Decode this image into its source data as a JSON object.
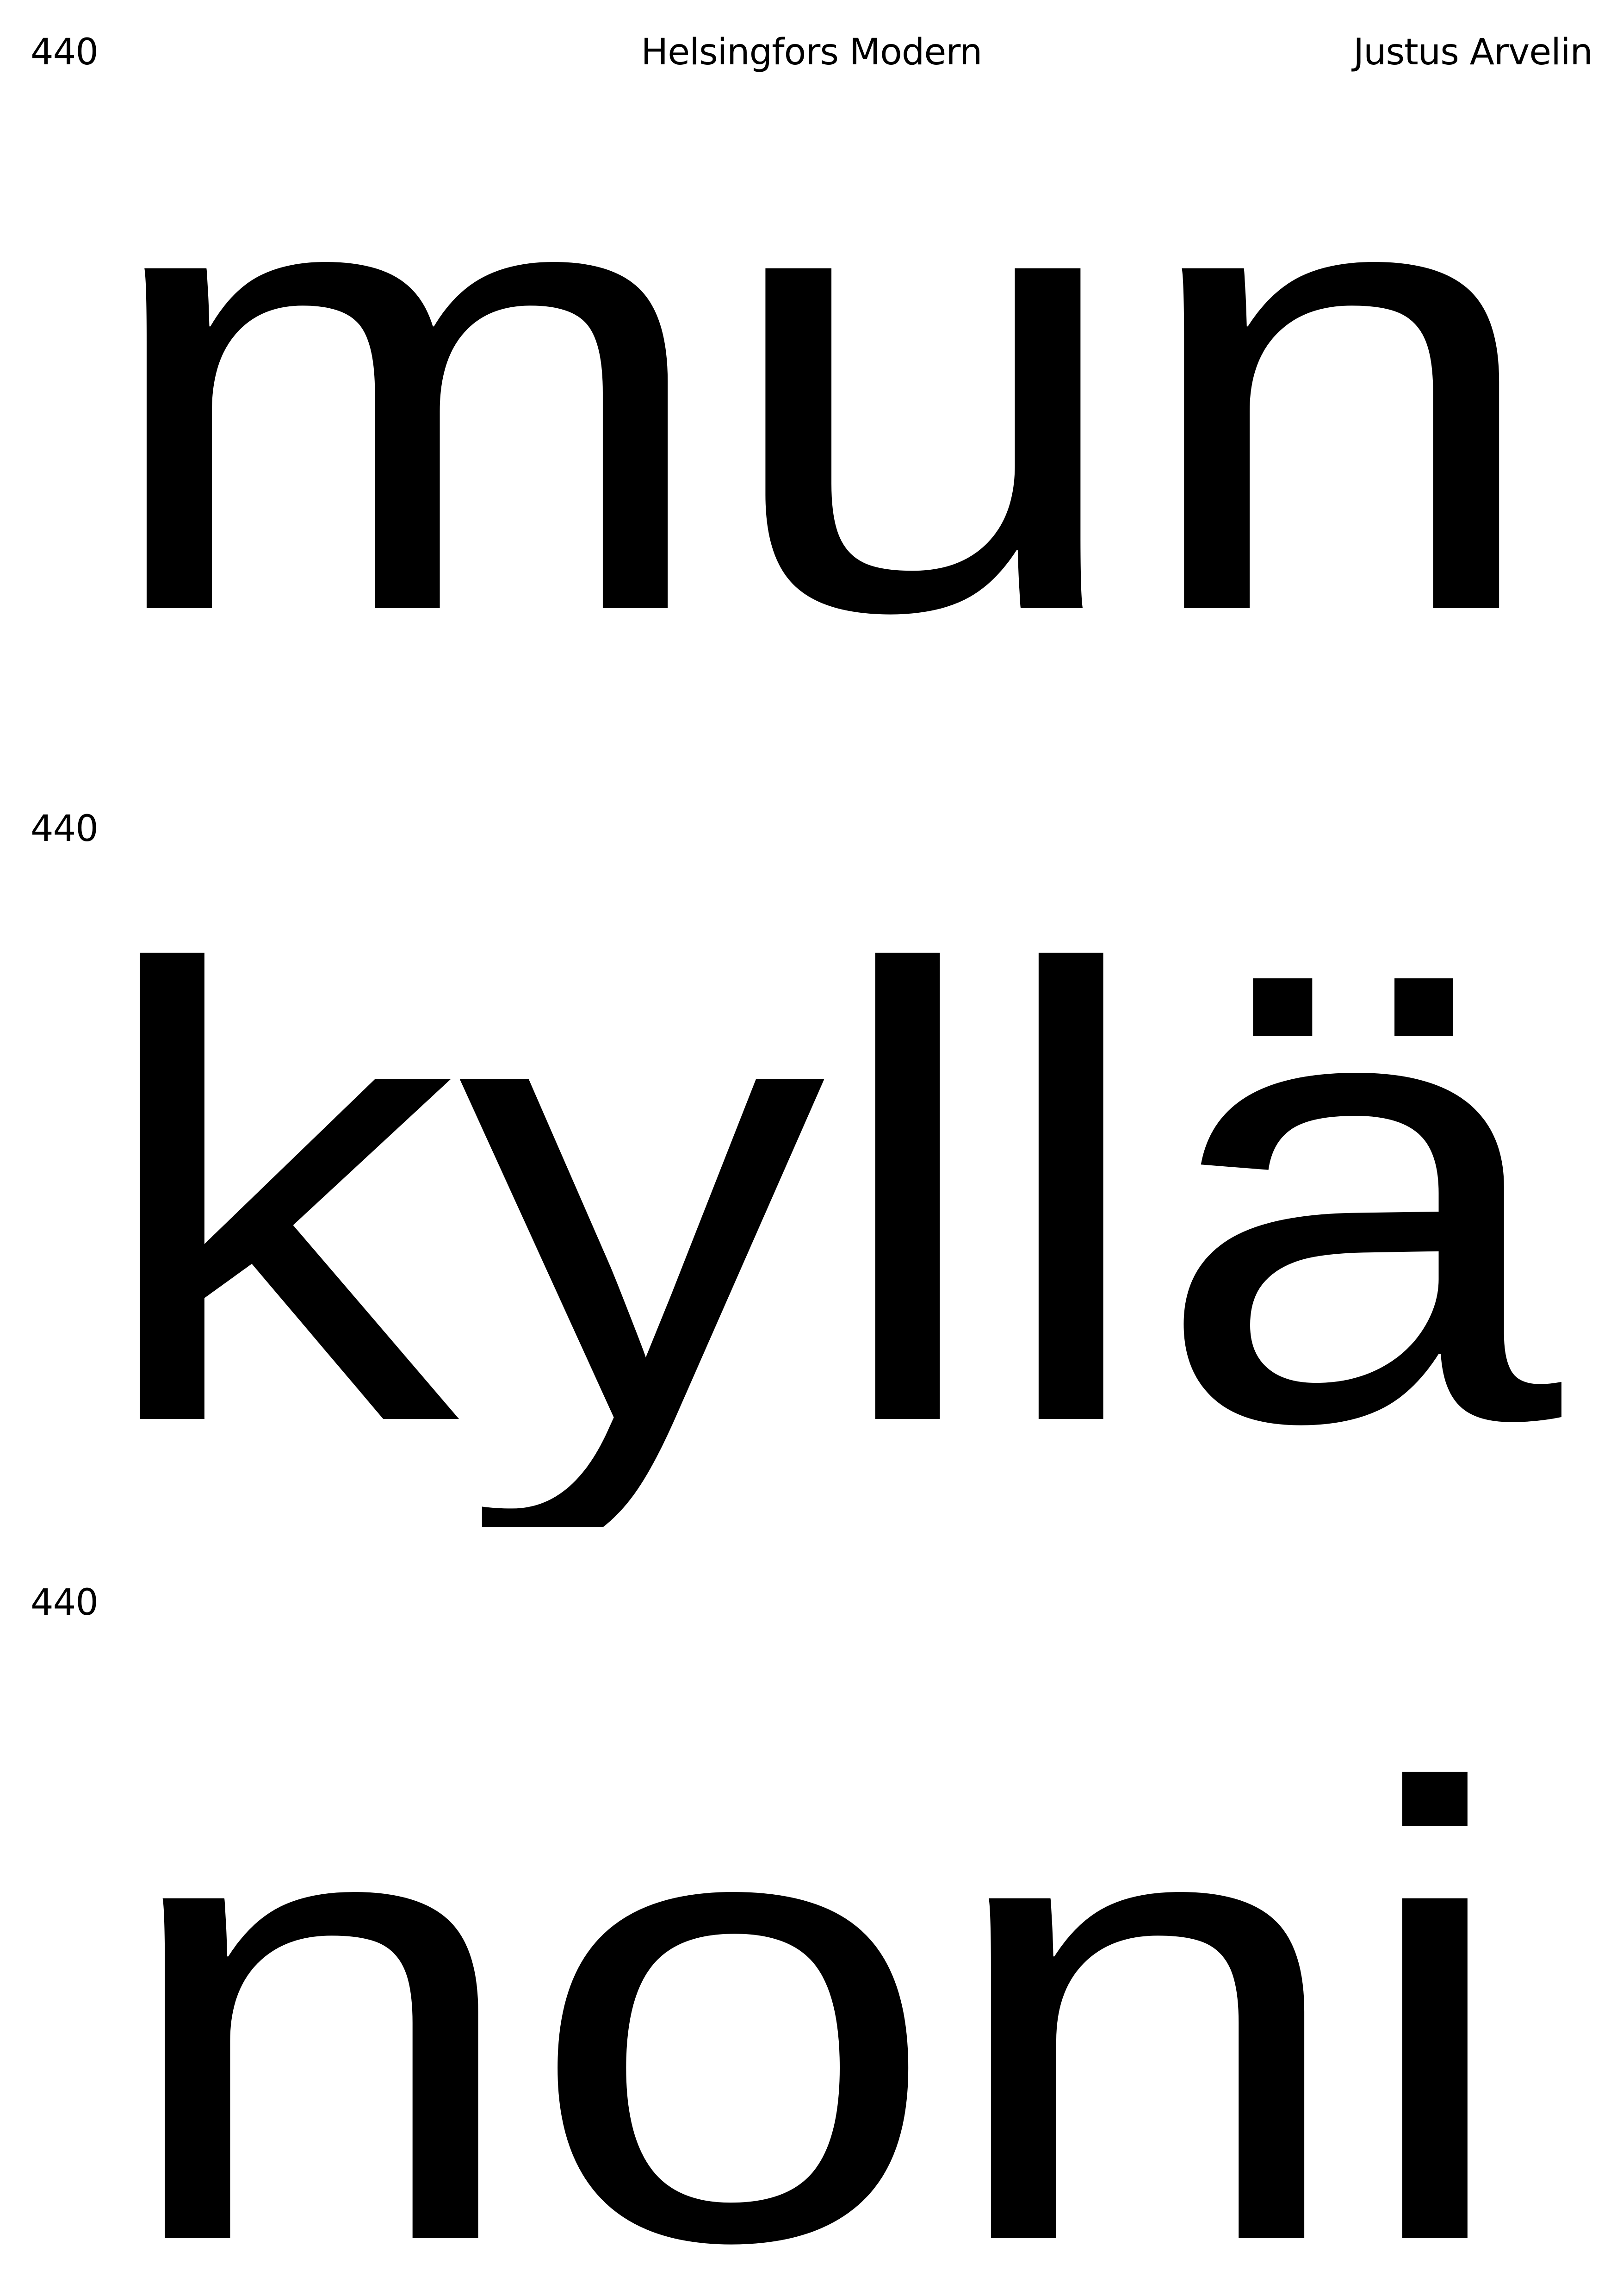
{
  "header": {
    "size": "440",
    "font_name": "Helsingfors Modern",
    "designer": "Justus Arvelin"
  },
  "rows": [
    {
      "size": "440",
      "word": "mun"
    },
    {
      "size": "440",
      "word": "kyllä"
    },
    {
      "size": "440",
      "word": "noni"
    }
  ],
  "colors": {
    "background": "#ffffff",
    "ink": "#000000"
  }
}
